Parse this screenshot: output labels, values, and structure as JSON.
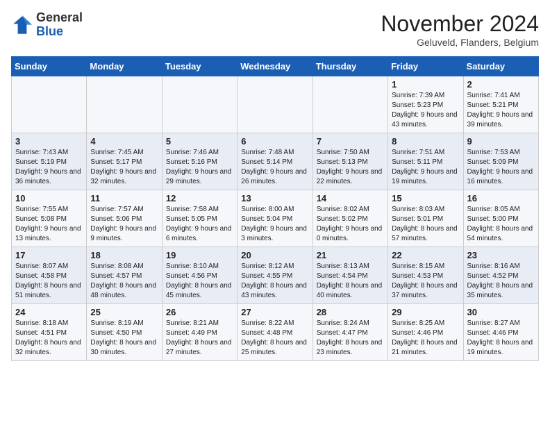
{
  "logo": {
    "line1": "General",
    "line2": "Blue"
  },
  "title": "November 2024",
  "location": "Geluveld, Flanders, Belgium",
  "days_of_week": [
    "Sunday",
    "Monday",
    "Tuesday",
    "Wednesday",
    "Thursday",
    "Friday",
    "Saturday"
  ],
  "weeks": [
    [
      {
        "day": "",
        "info": ""
      },
      {
        "day": "",
        "info": ""
      },
      {
        "day": "",
        "info": ""
      },
      {
        "day": "",
        "info": ""
      },
      {
        "day": "",
        "info": ""
      },
      {
        "day": "1",
        "info": "Sunrise: 7:39 AM\nSunset: 5:23 PM\nDaylight: 9 hours\nand 43 minutes."
      },
      {
        "day": "2",
        "info": "Sunrise: 7:41 AM\nSunset: 5:21 PM\nDaylight: 9 hours\nand 39 minutes."
      }
    ],
    [
      {
        "day": "3",
        "info": "Sunrise: 7:43 AM\nSunset: 5:19 PM\nDaylight: 9 hours\nand 36 minutes."
      },
      {
        "day": "4",
        "info": "Sunrise: 7:45 AM\nSunset: 5:17 PM\nDaylight: 9 hours\nand 32 minutes."
      },
      {
        "day": "5",
        "info": "Sunrise: 7:46 AM\nSunset: 5:16 PM\nDaylight: 9 hours\nand 29 minutes."
      },
      {
        "day": "6",
        "info": "Sunrise: 7:48 AM\nSunset: 5:14 PM\nDaylight: 9 hours\nand 26 minutes."
      },
      {
        "day": "7",
        "info": "Sunrise: 7:50 AM\nSunset: 5:13 PM\nDaylight: 9 hours\nand 22 minutes."
      },
      {
        "day": "8",
        "info": "Sunrise: 7:51 AM\nSunset: 5:11 PM\nDaylight: 9 hours\nand 19 minutes."
      },
      {
        "day": "9",
        "info": "Sunrise: 7:53 AM\nSunset: 5:09 PM\nDaylight: 9 hours\nand 16 minutes."
      }
    ],
    [
      {
        "day": "10",
        "info": "Sunrise: 7:55 AM\nSunset: 5:08 PM\nDaylight: 9 hours\nand 13 minutes."
      },
      {
        "day": "11",
        "info": "Sunrise: 7:57 AM\nSunset: 5:06 PM\nDaylight: 9 hours\nand 9 minutes."
      },
      {
        "day": "12",
        "info": "Sunrise: 7:58 AM\nSunset: 5:05 PM\nDaylight: 9 hours\nand 6 minutes."
      },
      {
        "day": "13",
        "info": "Sunrise: 8:00 AM\nSunset: 5:04 PM\nDaylight: 9 hours\nand 3 minutes."
      },
      {
        "day": "14",
        "info": "Sunrise: 8:02 AM\nSunset: 5:02 PM\nDaylight: 9 hours\nand 0 minutes."
      },
      {
        "day": "15",
        "info": "Sunrise: 8:03 AM\nSunset: 5:01 PM\nDaylight: 8 hours\nand 57 minutes."
      },
      {
        "day": "16",
        "info": "Sunrise: 8:05 AM\nSunset: 5:00 PM\nDaylight: 8 hours\nand 54 minutes."
      }
    ],
    [
      {
        "day": "17",
        "info": "Sunrise: 8:07 AM\nSunset: 4:58 PM\nDaylight: 8 hours\nand 51 minutes."
      },
      {
        "day": "18",
        "info": "Sunrise: 8:08 AM\nSunset: 4:57 PM\nDaylight: 8 hours\nand 48 minutes."
      },
      {
        "day": "19",
        "info": "Sunrise: 8:10 AM\nSunset: 4:56 PM\nDaylight: 8 hours\nand 45 minutes."
      },
      {
        "day": "20",
        "info": "Sunrise: 8:12 AM\nSunset: 4:55 PM\nDaylight: 8 hours\nand 43 minutes."
      },
      {
        "day": "21",
        "info": "Sunrise: 8:13 AM\nSunset: 4:54 PM\nDaylight: 8 hours\nand 40 minutes."
      },
      {
        "day": "22",
        "info": "Sunrise: 8:15 AM\nSunset: 4:53 PM\nDaylight: 8 hours\nand 37 minutes."
      },
      {
        "day": "23",
        "info": "Sunrise: 8:16 AM\nSunset: 4:52 PM\nDaylight: 8 hours\nand 35 minutes."
      }
    ],
    [
      {
        "day": "24",
        "info": "Sunrise: 8:18 AM\nSunset: 4:51 PM\nDaylight: 8 hours\nand 32 minutes."
      },
      {
        "day": "25",
        "info": "Sunrise: 8:19 AM\nSunset: 4:50 PM\nDaylight: 8 hours\nand 30 minutes."
      },
      {
        "day": "26",
        "info": "Sunrise: 8:21 AM\nSunset: 4:49 PM\nDaylight: 8 hours\nand 27 minutes."
      },
      {
        "day": "27",
        "info": "Sunrise: 8:22 AM\nSunset: 4:48 PM\nDaylight: 8 hours\nand 25 minutes."
      },
      {
        "day": "28",
        "info": "Sunrise: 8:24 AM\nSunset: 4:47 PM\nDaylight: 8 hours\nand 23 minutes."
      },
      {
        "day": "29",
        "info": "Sunrise: 8:25 AM\nSunset: 4:46 PM\nDaylight: 8 hours\nand 21 minutes."
      },
      {
        "day": "30",
        "info": "Sunrise: 8:27 AM\nSunset: 4:46 PM\nDaylight: 8 hours\nand 19 minutes."
      }
    ]
  ]
}
